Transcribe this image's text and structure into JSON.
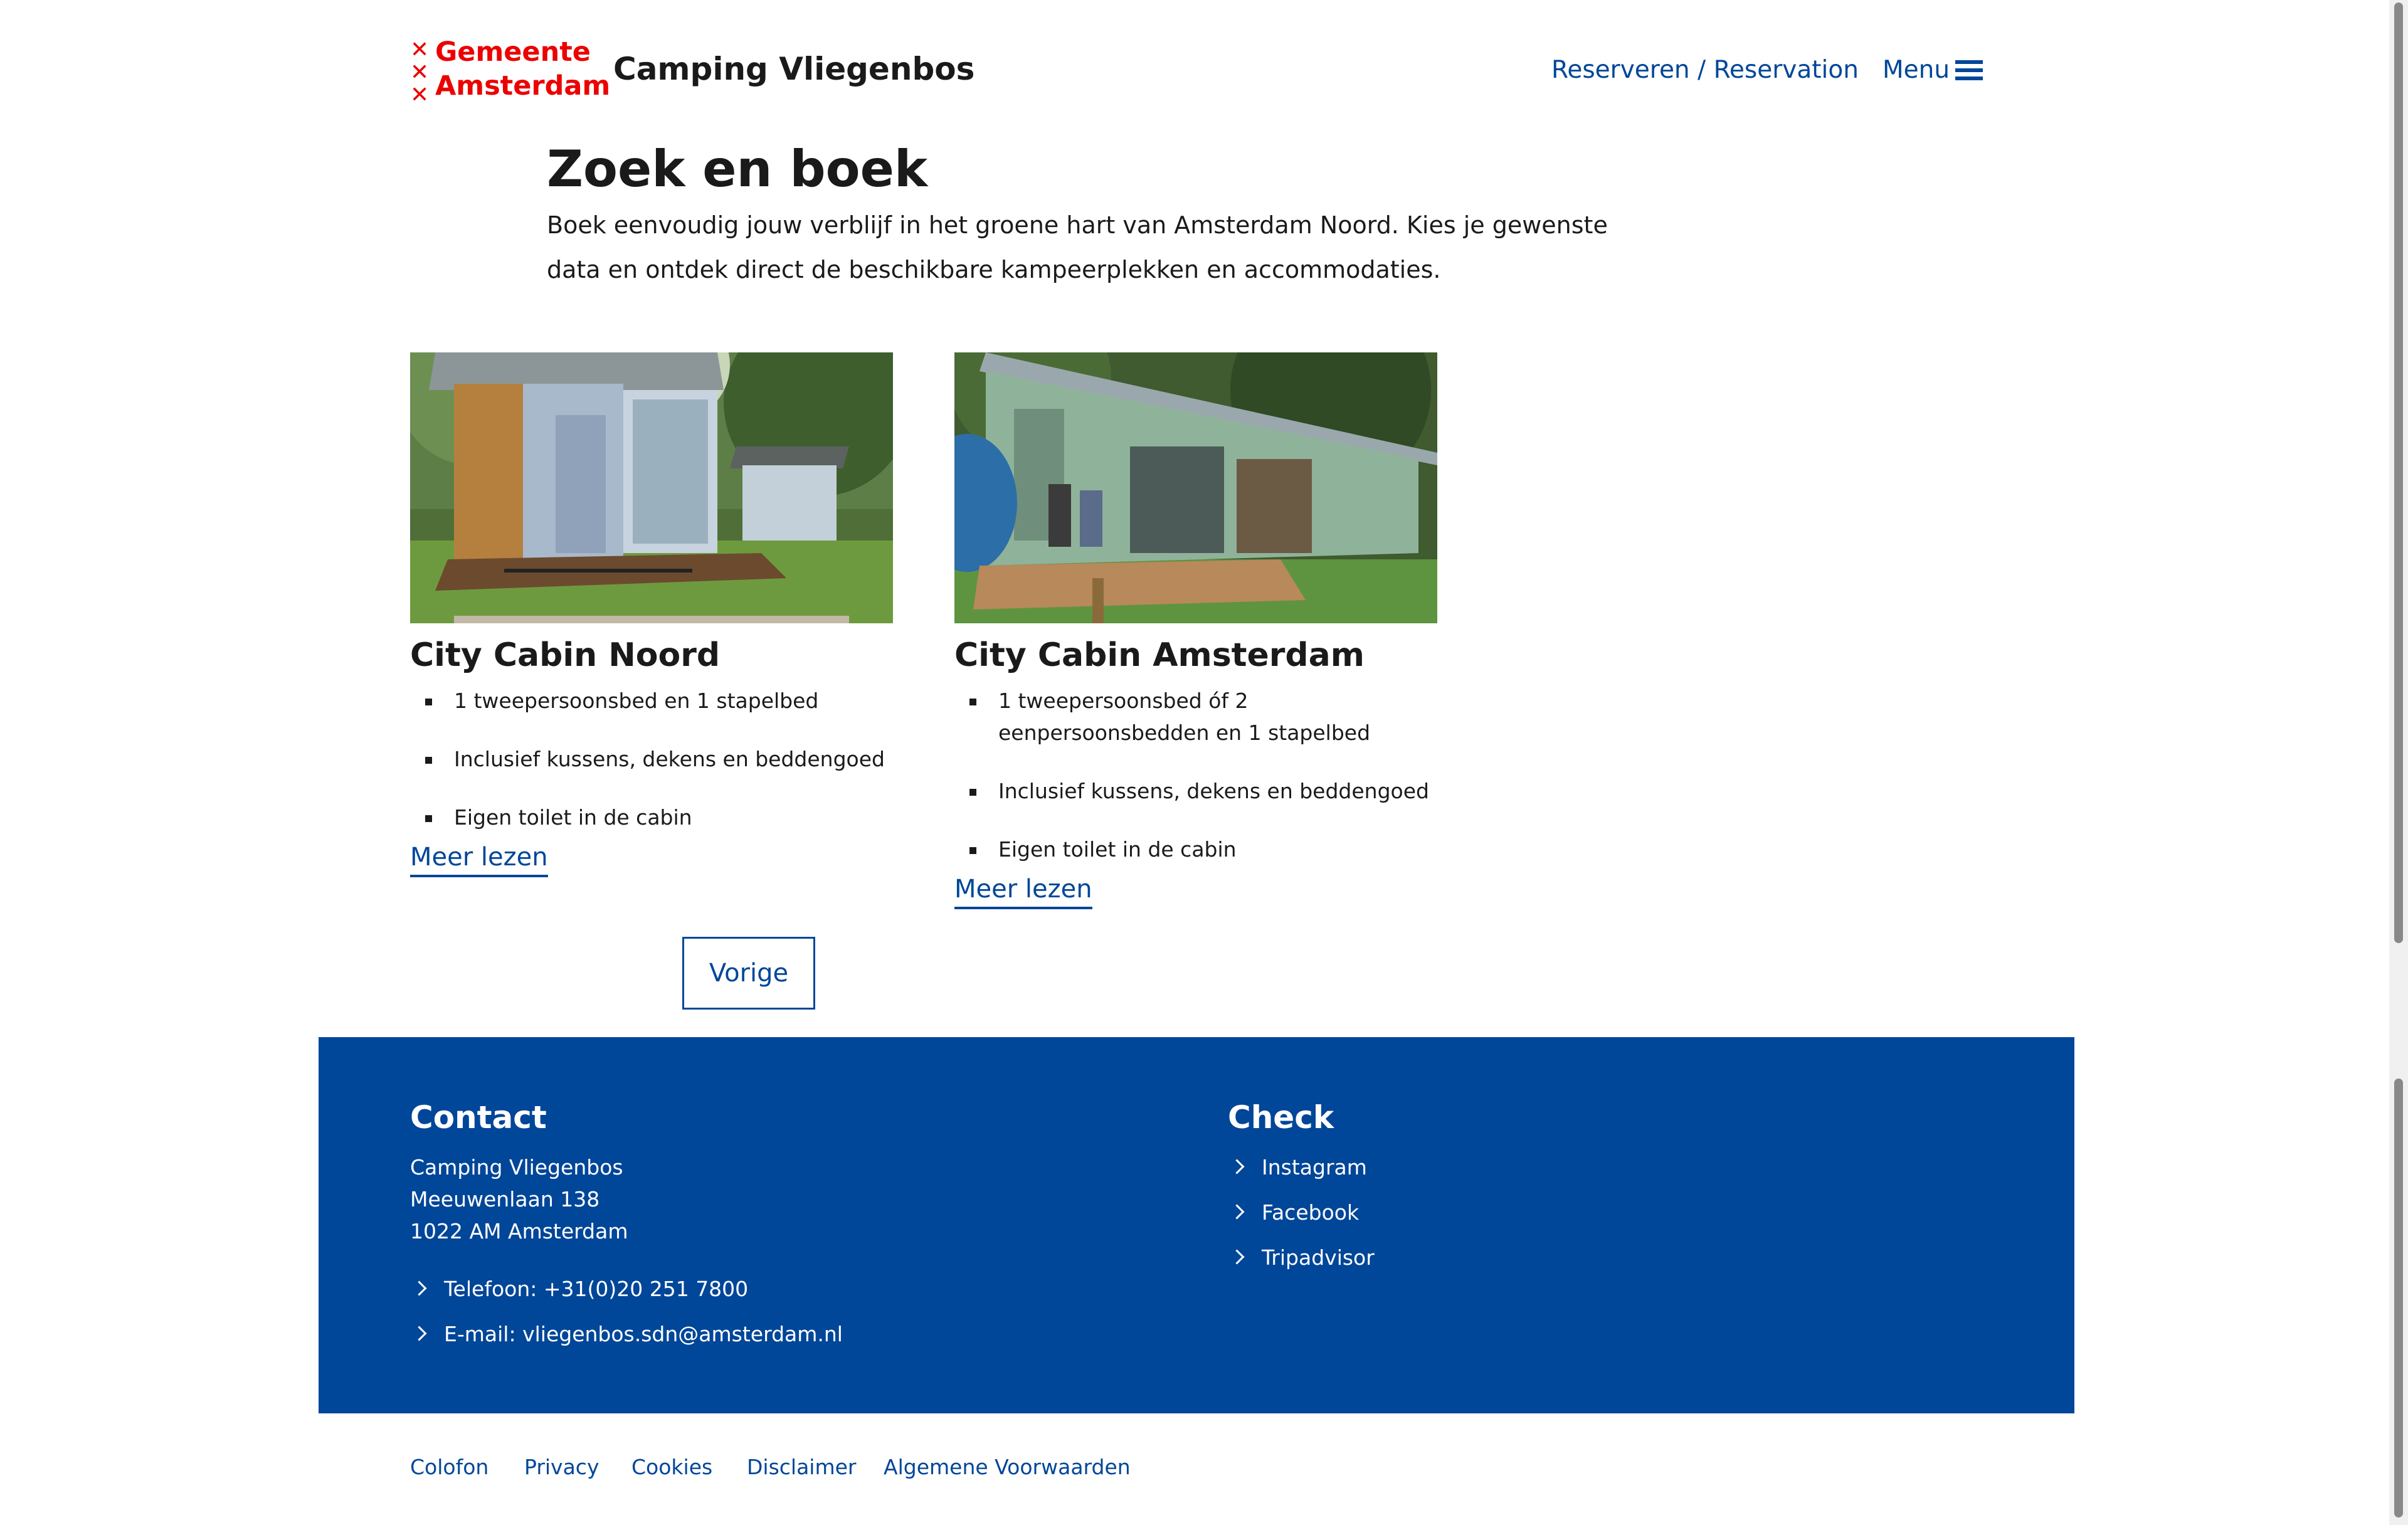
{
  "header": {
    "logo_line1": "Gemeente",
    "logo_line2": "Amsterdam",
    "site_title": "Camping Vliegenbos",
    "nav_reserve": "Reserveren / Reservation",
    "nav_menu": "Menu"
  },
  "intro": {
    "title": "Zoek en boek",
    "text": "Boek eenvoudig jouw verblijf in het groene hart van Amsterdam Noord. Kies je gewenste data en ontdek direct de beschikbare kampeerplekken en accommodaties."
  },
  "cards": [
    {
      "title": "City Cabin Noord",
      "features": [
        "1 tweepersoonsbed en 1 stapelbed",
        "Inclusief kussens, dekens en beddengoed",
        "Eigen toilet in de cabin"
      ],
      "link": "Meer lezen"
    },
    {
      "title": "City Cabin Amsterdam",
      "features": [
        "1 tweepersoonsbed óf 2 eenpersoonsbedden en 1 stapelbed",
        "Inclusief kussens, dekens en beddengoed",
        "Eigen toilet in de cabin"
      ],
      "link": "Meer lezen"
    }
  ],
  "pagination": {
    "prev": "Vorige"
  },
  "footer": {
    "contact_title": "Contact",
    "address": [
      "Camping Vliegenbos",
      "Meeuwenlaan 138",
      "1022 AM Amsterdam"
    ],
    "phone": "Telefoon: +31(0)20 251 7800",
    "email": "E-mail: vliegenbos.sdn@amsterdam.nl",
    "check_title": "Check",
    "social": [
      "Instagram",
      "Facebook",
      "Tripadvisor"
    ]
  },
  "legal": [
    "Colofon",
    "Privacy",
    "Cookies",
    "Disclaimer",
    "Algemene Voorwaarden"
  ],
  "colors": {
    "brand_blue": "#004699",
    "brand_red": "#ec0000"
  }
}
